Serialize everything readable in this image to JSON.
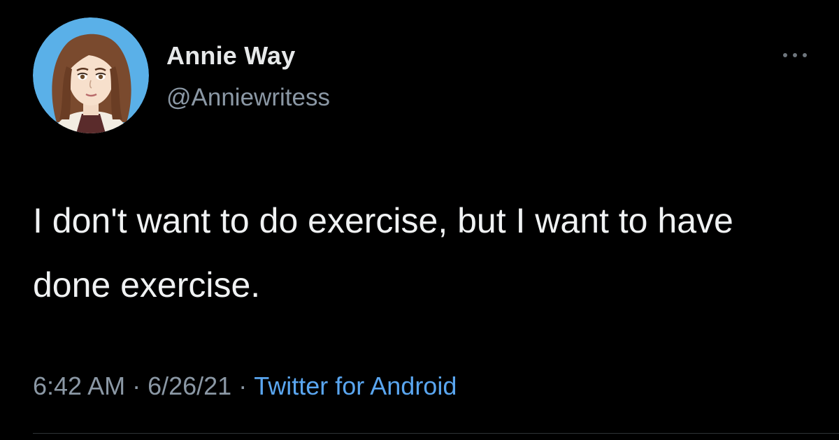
{
  "tweet": {
    "display_name": "Annie Way",
    "handle": "@Anniewritess",
    "text": "I don't want to do exercise, but I want to have done exercise.",
    "time": "6:42 AM",
    "date": "6/26/21",
    "separator": "·",
    "source": "Twitter for Android"
  },
  "icons": {
    "avatar": "cartoon-woman-avatar-icon",
    "more": "more-horizontal-icon"
  },
  "colors": {
    "background": "#000000",
    "primary_text": "#e7e9ea",
    "secondary_text": "#8b98a5",
    "link": "#5aa6f0",
    "avatar_background": "#5ab0e8"
  }
}
